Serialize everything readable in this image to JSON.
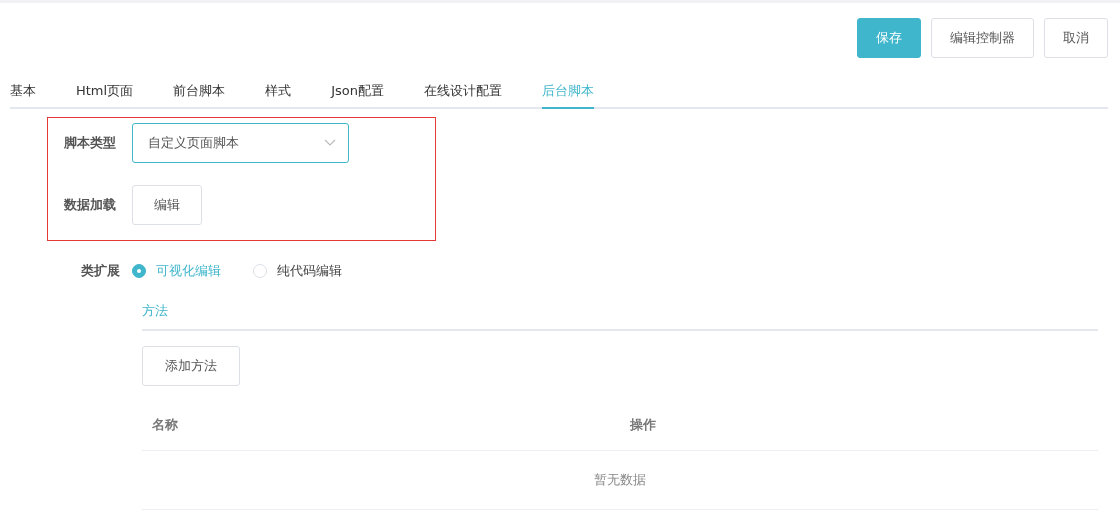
{
  "actions": [
    {
      "label": "保存",
      "kind": "primary"
    },
    {
      "label": "编辑控制器",
      "kind": "default"
    },
    {
      "label": "取消",
      "kind": "default"
    }
  ],
  "tabs": [
    {
      "label": "基本",
      "selected": false
    },
    {
      "label": "Html页面",
      "selected": false
    },
    {
      "label": "前台脚本",
      "selected": false
    },
    {
      "label": "样式",
      "selected": false
    },
    {
      "label": "Json配置",
      "selected": false
    },
    {
      "label": "在线设计配置",
      "selected": false
    },
    {
      "label": "后台脚本",
      "selected": true
    }
  ],
  "script_type": {
    "label": "脚本类型",
    "value": "自定义页面脚本"
  },
  "data_loading": {
    "label": "数据加载",
    "button": "编辑"
  },
  "class_extension": {
    "label": "类扩展",
    "options": [
      {
        "label": "可视化编辑",
        "selected": true
      },
      {
        "label": "纯代码编辑",
        "selected": false
      }
    ]
  },
  "sub_tabs": [
    {
      "label": "方法",
      "selected": true
    }
  ],
  "add_button": "添加方法",
  "table": {
    "columns": [
      "名称",
      "操作"
    ],
    "empty_text": "暂无数据"
  }
}
